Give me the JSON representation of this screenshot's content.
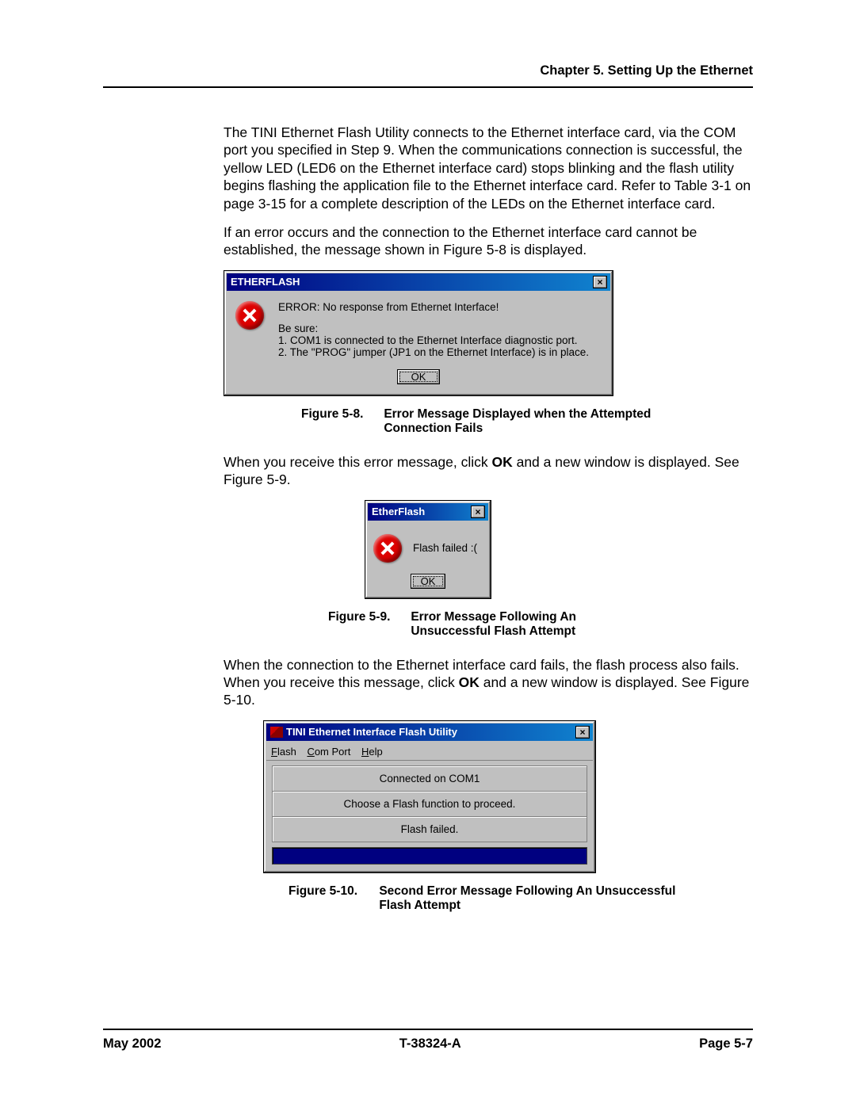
{
  "header": {
    "chapter": "Chapter 5. Setting Up the Ethernet"
  },
  "para1": "The TINI Ethernet Flash Utility connects to the Ethernet interface card, via the COM port you specified in Step 9. When the communications connection is successful, the yellow LED (LED6 on the Ethernet interface card) stops blinking and the flash utility begins flashing the application file to the Ethernet interface card. Refer to Table 3-1 on page 3-15 for a complete description of the LEDs on the Ethernet interface card.",
  "para2": "If an error occurs and the connection to the Ethernet interface card cannot be established, the message shown in Figure 5-8 is displayed.",
  "dialog1": {
    "title": "ETHERFLASH",
    "line1": "ERROR: No response from Ethernet Interface!",
    "line2": "Be sure:",
    "line3": "1. COM1 is connected to the Ethernet Interface diagnostic port.",
    "line4": "2. The \"PROG\" jumper (JP1 on the Ethernet Interface) is in place.",
    "ok": "OK"
  },
  "caption1": {
    "label": "Figure 5-8.",
    "text_a": "Error Message Displayed when the Attempted",
    "text_b": "Connection Fails"
  },
  "para3_a": "When you receive this error message, click ",
  "para3_bold": "OK",
  "para3_b": " and a new window is displayed. See Figure 5-9.",
  "dialog2": {
    "title": "EtherFlash",
    "msg": "Flash failed :(",
    "ok": "OK"
  },
  "caption2": {
    "label": "Figure 5-9.",
    "text_a": "Error Message Following An",
    "text_b": "Unsuccessful Flash Attempt"
  },
  "para4_a": "When the connection to the Ethernet interface card fails, the flash process also fails. When you receive this message, click ",
  "para4_bold": "OK",
  "para4_b": " and a new window is displayed. See Figure 5-10.",
  "dialog3": {
    "title": "TINI Ethernet Interface Flash Utility",
    "menu": {
      "flash": "Flash",
      "com": "Com Port",
      "help": "Help"
    },
    "line1": "Connected on COM1",
    "line2": "Choose a Flash function to proceed.",
    "line3": "Flash failed."
  },
  "caption3": {
    "label": "Figure 5-10.",
    "text_a": "Second Error Message Following An Unsuccessful",
    "text_b": "Flash Attempt"
  },
  "footer": {
    "left": "May 2002",
    "center": "T-38324-A",
    "right": "Page 5-7"
  }
}
